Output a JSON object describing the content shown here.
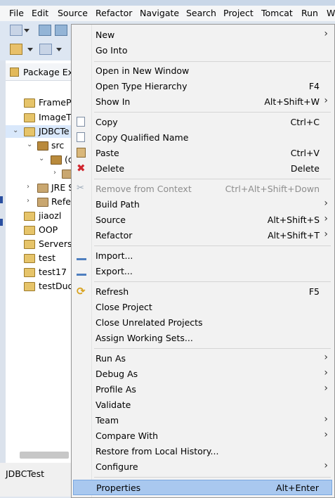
{
  "menubar": [
    "File",
    "Edit",
    "Source",
    "Refactor",
    "Navigate",
    "Search",
    "Project",
    "Tomcat",
    "Run",
    "W"
  ],
  "package_explorer": {
    "title": "Package Ex",
    "items": [
      {
        "label": "FramePr"
      },
      {
        "label": "ImageT"
      },
      {
        "label": "JDBCTe"
      },
      {
        "label": "src"
      },
      {
        "label": "(d"
      },
      {
        "label": ""
      },
      {
        "label": "JRE S"
      },
      {
        "label": "Refe"
      },
      {
        "label": "jiaozl"
      },
      {
        "label": "OOP"
      },
      {
        "label": "Servers"
      },
      {
        "label": "test"
      },
      {
        "label": "test17"
      },
      {
        "label": "testDuo"
      }
    ]
  },
  "statusbar": {
    "selected_project": "JDBCTest"
  },
  "context_menu": {
    "items": [
      {
        "label": "New",
        "shortcut": "",
        "submenu": "›"
      },
      {
        "label": "Go Into",
        "shortcut": "",
        "submenu": ""
      },
      {
        "label": "Open in New Window",
        "shortcut": "",
        "submenu": ""
      },
      {
        "label": "Open Type Hierarchy",
        "shortcut": "F4",
        "submenu": ""
      },
      {
        "label": "Show In",
        "shortcut": "Alt+Shift+W",
        "submenu": "›"
      },
      {
        "label": "Copy",
        "shortcut": "Ctrl+C",
        "submenu": ""
      },
      {
        "label": "Copy Qualified Name",
        "shortcut": "",
        "submenu": ""
      },
      {
        "label": "Paste",
        "shortcut": "Ctrl+V",
        "submenu": ""
      },
      {
        "label": "Delete",
        "shortcut": "Delete",
        "submenu": ""
      },
      {
        "label": "Remove from Context",
        "shortcut": "Ctrl+Alt+Shift+Down",
        "submenu": ""
      },
      {
        "label": "Build Path",
        "shortcut": "",
        "submenu": "›"
      },
      {
        "label": "Source",
        "shortcut": "Alt+Shift+S",
        "submenu": "›"
      },
      {
        "label": "Refactor",
        "shortcut": "Alt+Shift+T",
        "submenu": "›"
      },
      {
        "label": "Import...",
        "shortcut": "",
        "submenu": ""
      },
      {
        "label": "Export...",
        "shortcut": "",
        "submenu": ""
      },
      {
        "label": "Refresh",
        "shortcut": "F5",
        "submenu": ""
      },
      {
        "label": "Close Project",
        "shortcut": "",
        "submenu": ""
      },
      {
        "label": "Close Unrelated Projects",
        "shortcut": "",
        "submenu": ""
      },
      {
        "label": "Assign Working Sets...",
        "shortcut": "",
        "submenu": ""
      },
      {
        "label": "Run As",
        "shortcut": "",
        "submenu": "›"
      },
      {
        "label": "Debug As",
        "shortcut": "",
        "submenu": "›"
      },
      {
        "label": "Profile As",
        "shortcut": "",
        "submenu": "›"
      },
      {
        "label": "Validate",
        "shortcut": "",
        "submenu": ""
      },
      {
        "label": "Team",
        "shortcut": "",
        "submenu": "›"
      },
      {
        "label": "Compare With",
        "shortcut": "",
        "submenu": "›"
      },
      {
        "label": "Restore from Local History...",
        "shortcut": "",
        "submenu": ""
      },
      {
        "label": "Configure",
        "shortcut": "",
        "submenu": "›"
      },
      {
        "label": "Properties",
        "shortcut": "Alt+Enter",
        "submenu": ""
      }
    ],
    "selected_label": "Properties",
    "disabled_labels": [
      "Remove from Context"
    ]
  },
  "colors": {
    "selection": "#a9c8ef",
    "delete_icon": "#d0262e"
  }
}
